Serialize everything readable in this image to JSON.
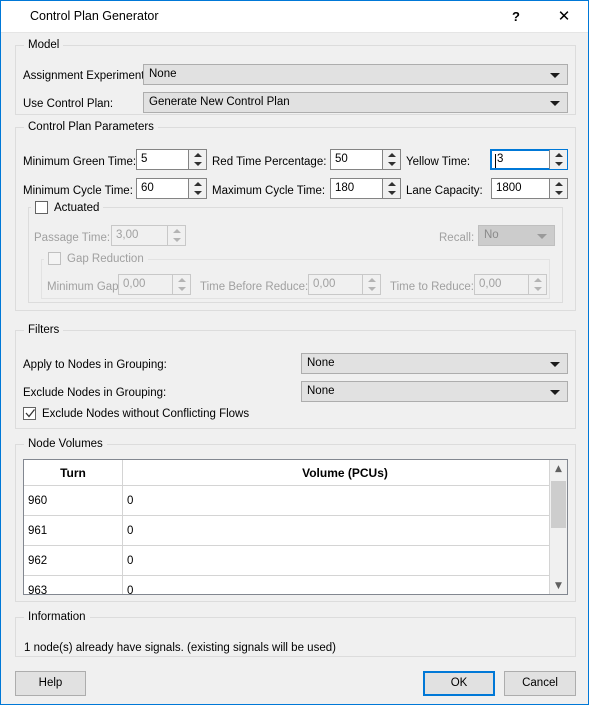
{
  "window": {
    "title": "Control Plan Generator",
    "help_icon": "question-mark-icon",
    "close_icon": "close-icon",
    "accent_color": "#0078d7",
    "background_color": "#f0f0f0"
  },
  "model": {
    "legend": "Model",
    "assignment_experiment": {
      "label": "Assignment Experiment:",
      "value": "None"
    },
    "use_control_plan": {
      "label": "Use Control Plan:",
      "value": "Generate New Control Plan"
    }
  },
  "parameters": {
    "legend": "Control Plan Parameters",
    "fields": [
      {
        "label": "Minimum Green Time:",
        "value": "5"
      },
      {
        "label": "Red Time Percentage:",
        "value": "50"
      },
      {
        "label": "Yellow Time:",
        "value": "3"
      },
      {
        "label": "Minimum Cycle Time:",
        "value": "60"
      },
      {
        "label": "Maximum Cycle Time:",
        "value": "180"
      },
      {
        "label": "Lane Capacity:",
        "value": "1800"
      }
    ],
    "actuated": {
      "legend": "Actuated",
      "checked": false,
      "passage_time": {
        "label": "Passage Time:",
        "value": "3,00"
      },
      "recall": {
        "label": "Recall:",
        "value": "No"
      },
      "gap_reduction": {
        "legend": "Gap Reduction",
        "checked": false,
        "fields": [
          {
            "label": "Minimum Gap:",
            "value": "0,00"
          },
          {
            "label": "Time Before Reduce:",
            "value": "0,00"
          },
          {
            "label": "Time to Reduce:",
            "value": "0,00"
          }
        ]
      }
    }
  },
  "filters": {
    "legend": "Filters",
    "apply_to_nodes": {
      "label": "Apply to Nodes in Grouping:",
      "value": "None"
    },
    "exclude_nodes": {
      "label": "Exclude Nodes in Grouping:",
      "value": "None"
    },
    "exclude_without_conflicting": {
      "label": "Exclude Nodes without Conflicting Flows",
      "checked": true
    }
  },
  "node_volumes": {
    "legend": "Node Volumes",
    "columns": [
      "Turn",
      "Volume  (PCUs)"
    ],
    "rows": [
      {
        "turn": "960",
        "volume": "0"
      },
      {
        "turn": "961",
        "volume": "0"
      },
      {
        "turn": "962",
        "volume": "0"
      },
      {
        "turn": "963",
        "volume": "0"
      }
    ],
    "scroll_up_icon": "chevron-up-icon",
    "scroll_down_icon": "chevron-down-icon"
  },
  "information": {
    "legend": "Information",
    "message": "1 node(s) already have signals. (existing signals will be used)"
  },
  "footer": {
    "help": "Help",
    "ok": "OK",
    "cancel": "Cancel"
  }
}
